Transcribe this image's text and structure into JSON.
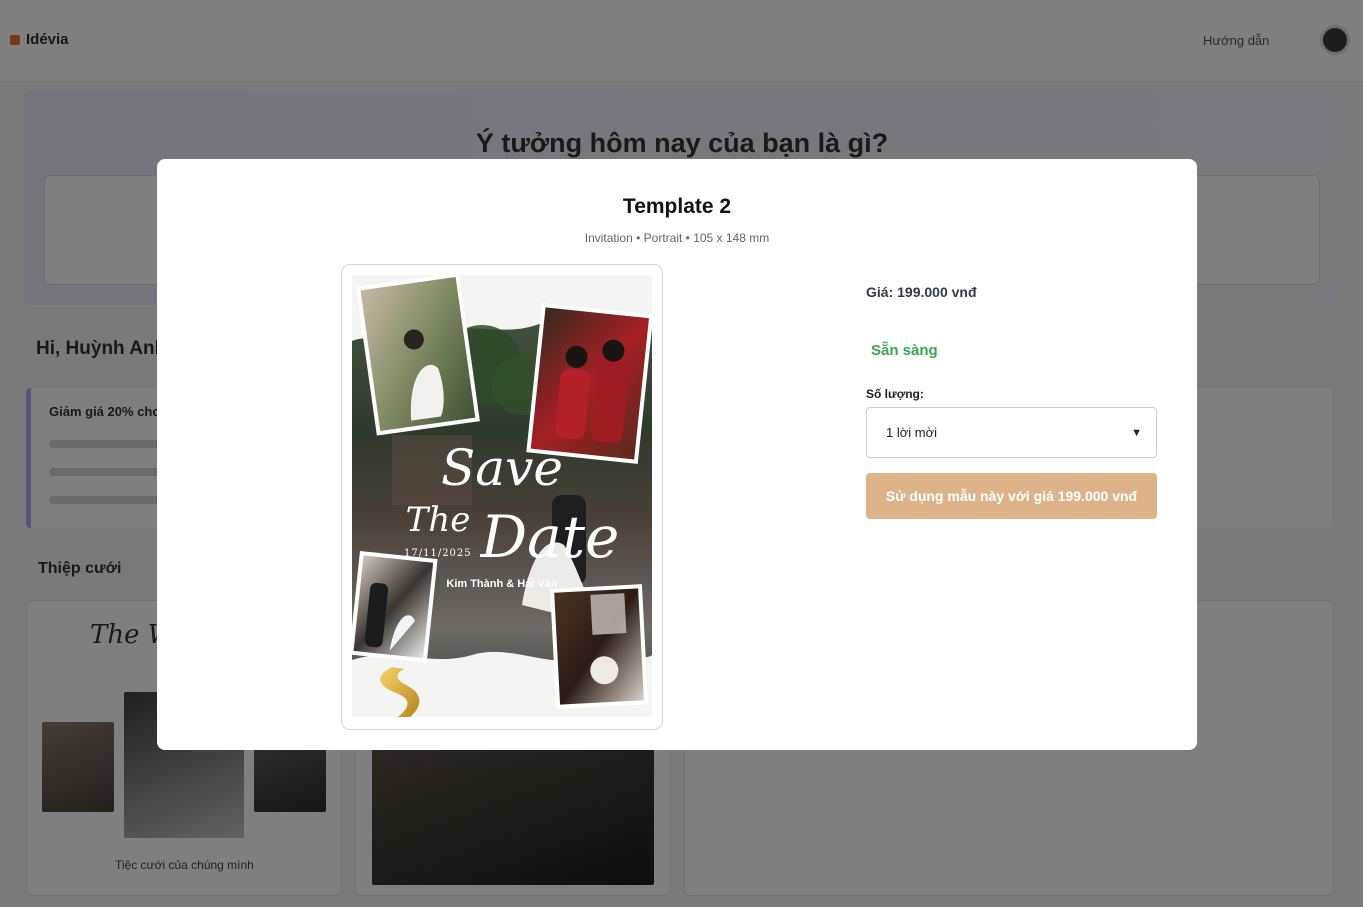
{
  "background": {
    "logo_text": "Idévia",
    "guide_link": "Hướng dẫn",
    "hero_title": "Ý tưởng hôm nay của bạn là gì?",
    "section_heading": "Hi, Huỳnh Anh",
    "note_title": "Giảm giá 20% cho đơn hàng đầu tiên",
    "sub_heading": "Thiệp cưới",
    "card_script": "The Wedding",
    "card_caption": "Tiệc cưới của chúng mình"
  },
  "modal": {
    "title": "Template 2",
    "subtitle": "Invitation • Portrait • 105 x 148 mm",
    "price_label": "Giá: 199.000 vnđ",
    "status": "Sẵn sàng",
    "quantity_label": "Số lượng:",
    "quantity_selected": "1 lời mời",
    "use_button": "Sử dụng mẫu này với giá 199.000 vnđ"
  },
  "preview": {
    "save_text": "Save",
    "the_text": "The",
    "date_text": "Date",
    "date_value": "17/11/2025",
    "names": "Kim Thành & Hải Vân"
  },
  "colors": {
    "accent_button": "#deb38a",
    "status_ready": "#3aa655",
    "overlay": "rgba(0,0,0,0.5)"
  },
  "icons": {
    "select_arrow": "chevron-down-icon"
  }
}
